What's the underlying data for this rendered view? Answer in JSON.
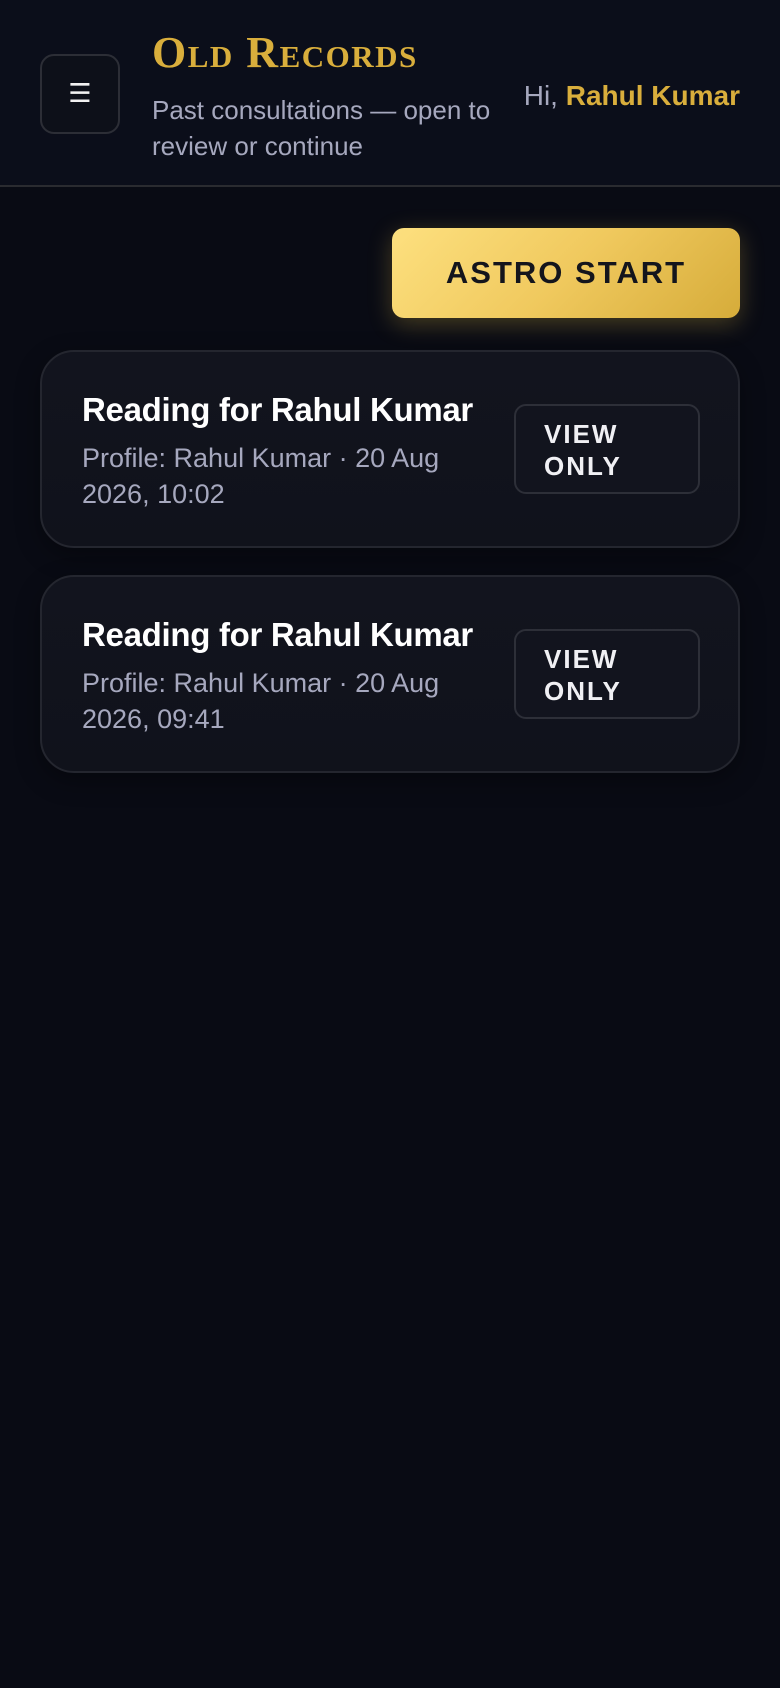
{
  "header": {
    "menu_icon": "hamburger-icon",
    "title": "Old Records",
    "subtitle": "Past consultations — open to review or continue",
    "greeting_prefix": "Hi,",
    "user_name": "Rahul Kumar"
  },
  "actions": {
    "start_label": "ASTRO START"
  },
  "records": [
    {
      "title": "Reading for Rahul Kumar",
      "meta": "Profile: Rahul Kumar · 20 Aug 2026, 10:02",
      "button_label": "VIEW ONLY"
    },
    {
      "title": "Reading for Rahul Kumar",
      "meta": "Profile: Rahul Kumar · 20 Aug 2026, 09:41",
      "button_label": "VIEW ONLY"
    }
  ],
  "colors": {
    "background": "#090b14",
    "accent_gold": "#d9ae3c",
    "muted_text": "#a6a8be"
  }
}
